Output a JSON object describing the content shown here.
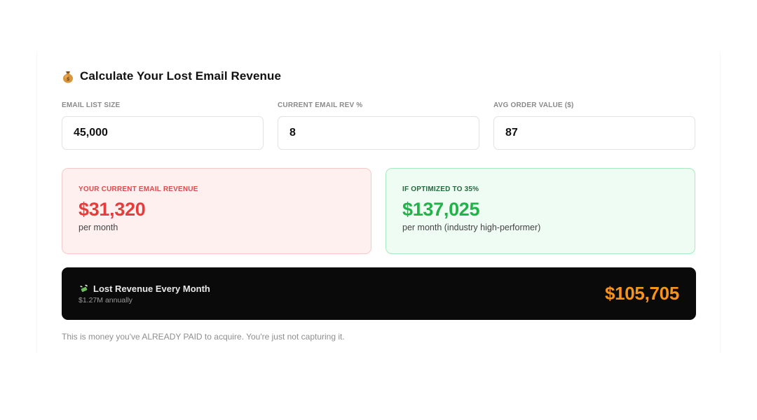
{
  "calculator": {
    "title": "Calculate Your Lost Email Revenue",
    "title_icon": "money-bag-icon",
    "fields": [
      {
        "label": "EMAIL LIST SIZE",
        "value": "45,000"
      },
      {
        "label": "CURRENT EMAIL REV %",
        "value": "8"
      },
      {
        "label": "AVG ORDER VALUE ($)",
        "value": "87"
      }
    ]
  },
  "results": {
    "current": {
      "label": "YOUR CURRENT EMAIL REVENUE",
      "value": "$31,320",
      "sub": "per month",
      "color": "#e83b3b"
    },
    "optimized": {
      "label": "IF OPTIMIZED TO 35%",
      "value": "$137,025",
      "sub": "per month (industry high-performer)",
      "color": "#22b24a"
    }
  },
  "lost": {
    "icon": "money-with-wings-icon",
    "title": "Lost Revenue Every Month",
    "sub": "$1.27M annually",
    "value": "$105,705",
    "value_color": "#f7931a"
  },
  "footnote": "This is money you've ALREADY PAID to acquire. You're just not capturing it."
}
